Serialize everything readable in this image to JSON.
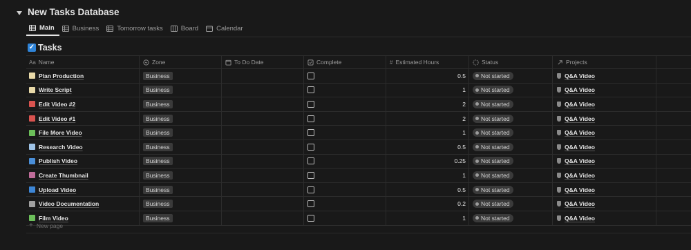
{
  "database": {
    "title": "New Tasks Database"
  },
  "views": [
    {
      "label": "Main",
      "icon": "table-icon",
      "active": true
    },
    {
      "label": "Business",
      "icon": "table-icon",
      "active": false
    },
    {
      "label": "Tomorrow tasks",
      "icon": "table-icon",
      "active": false
    },
    {
      "label": "Board",
      "icon": "board-icon",
      "active": false
    },
    {
      "label": "Calendar",
      "icon": "calendar-icon",
      "active": false
    }
  ],
  "table": {
    "title": "Tasks",
    "columns": {
      "name": "Name",
      "name_prefix": "Aa",
      "zone": "Zone",
      "date": "To Do Date",
      "complete": "Complete",
      "hours": "Estimated Hours",
      "status": "Status",
      "projects": "Projects"
    },
    "rows": [
      {
        "name": "Plan Production",
        "icon": "memo-icon",
        "icon_color": "#e8d9a8",
        "zone": "Business",
        "hours": "0.5",
        "status": "Not started",
        "project": "Q&A Video"
      },
      {
        "name": "Write Script",
        "icon": "memo-icon",
        "icon_color": "#e8d9a8",
        "zone": "Business",
        "hours": "1",
        "status": "Not started",
        "project": "Q&A Video"
      },
      {
        "name": "Edit Video #2",
        "icon": "scissors-icon",
        "icon_color": "#d9534f",
        "zone": "Business",
        "hours": "2",
        "status": "Not started",
        "project": "Q&A Video"
      },
      {
        "name": "Edit Video #1",
        "icon": "scissors-icon",
        "icon_color": "#d9534f",
        "zone": "Business",
        "hours": "2",
        "status": "Not started",
        "project": "Q&A Video"
      },
      {
        "name": "File More Video",
        "icon": "clapper-icon",
        "icon_color": "#6cbf5a",
        "zone": "Business",
        "hours": "1",
        "status": "Not started",
        "project": "Q&A Video"
      },
      {
        "name": "Research Video",
        "icon": "laptop-icon",
        "icon_color": "#9ec3e6",
        "zone": "Business",
        "hours": "0.5",
        "status": "Not started",
        "project": "Q&A Video"
      },
      {
        "name": "Publish Video",
        "icon": "monitor-icon",
        "icon_color": "#4a8fd9",
        "zone": "Business",
        "hours": "0.25",
        "status": "Not started",
        "project": "Q&A Video"
      },
      {
        "name": "Create Thumbnail",
        "icon": "image-icon",
        "icon_color": "#c06c9a",
        "zone": "Business",
        "hours": "1",
        "status": "Not started",
        "project": "Q&A Video"
      },
      {
        "name": "Upload Video",
        "icon": "upload-icon",
        "icon_color": "#3d86d6",
        "zone": "Business",
        "hours": "0.5",
        "status": "Not started",
        "project": "Q&A Video"
      },
      {
        "name": "Video Documentation",
        "icon": "phone-icon",
        "icon_color": "#a0a0a0",
        "zone": "Business",
        "hours": "0.2",
        "status": "Not started",
        "project": "Q&A Video"
      },
      {
        "name": "Film Video",
        "icon": "clapper-icon",
        "icon_color": "#6cbf5a",
        "zone": "Business",
        "hours": "1",
        "status": "Not started",
        "project": "Q&A Video"
      }
    ],
    "new_page_label": "New page"
  }
}
